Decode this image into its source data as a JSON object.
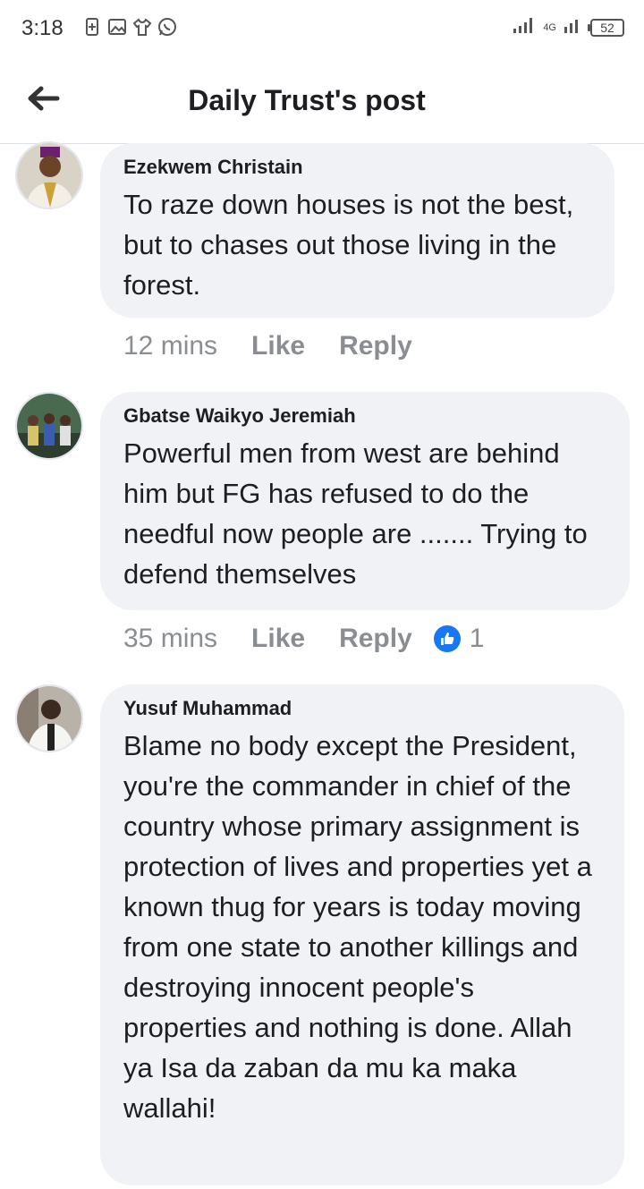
{
  "status_bar": {
    "time": "3:18",
    "network": "4G",
    "battery": "52",
    "icons": [
      "battery-saver-icon",
      "gallery-icon",
      "shirt-icon",
      "whatsapp-icon",
      "signal-icon"
    ]
  },
  "header": {
    "title": "Daily Trust's post",
    "back_icon": "arrow-left-icon"
  },
  "comments": [
    {
      "author": "Ezekwem Christain",
      "text": "To raze down houses is not the best, but to chases out those living in the forest.",
      "time": "12 mins",
      "like_label": "Like",
      "reply_label": "Reply",
      "reactions": null
    },
    {
      "author": "Gbatse Waikyo Jeremiah",
      "text": "Powerful men from west are behind him but FG has refused to do the needful now people are ....... Trying to defend themselves",
      "time": "35 mins",
      "like_label": "Like",
      "reply_label": "Reply",
      "reactions": "1"
    },
    {
      "author": "Yusuf Muhammad",
      "text": "Blame no body except the President, you're the commander in chief of the country whose primary assignment is protection of lives and properties yet a known thug for years is today moving from one state to another killings and destroying innocent people's properties and nothing is done. Allah ya Isa da zaban da mu ka maka wallahi!",
      "time": "",
      "like_label": "",
      "reply_label": "",
      "reactions": null
    }
  ],
  "colors": {
    "bubble": "#f0f2f5",
    "meta": "#8a8d91",
    "like_blue": "#1877f2"
  }
}
